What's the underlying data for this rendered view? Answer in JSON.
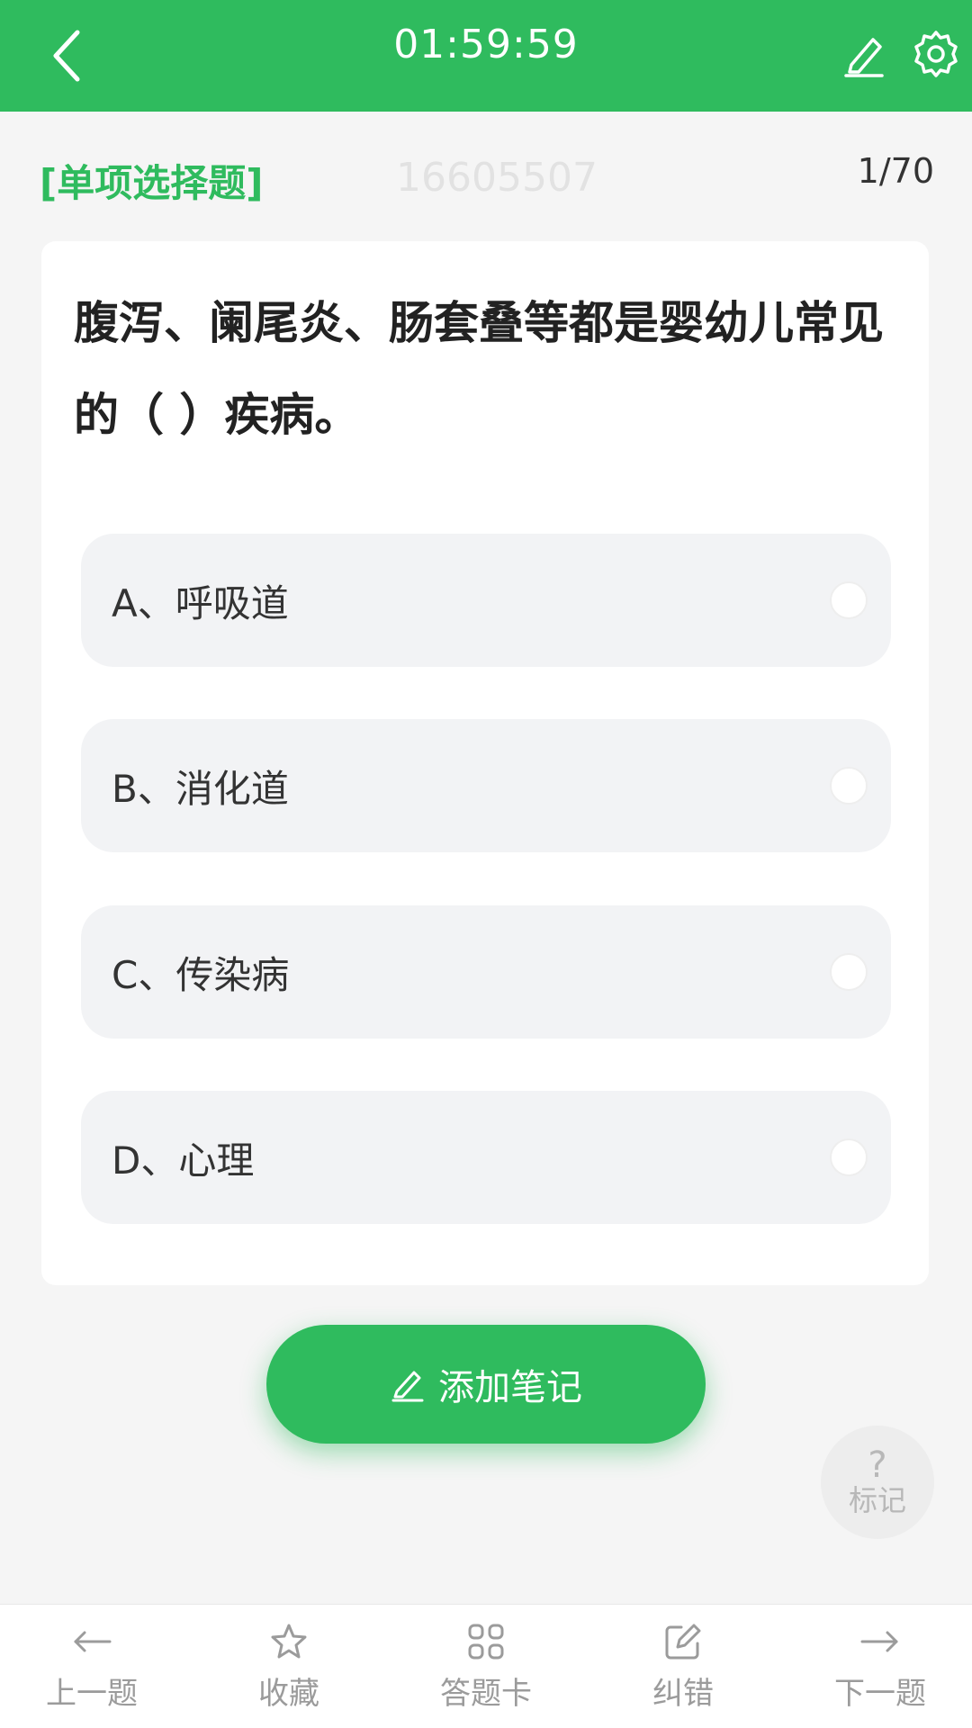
{
  "header": {
    "timer": "01:59:59",
    "bg_color": "#2fbb5e",
    "icons": [
      "back-arrow-icon",
      "pencil-icon",
      "gear-icon"
    ]
  },
  "subheader": {
    "question_type": "[单项选择题]",
    "watermark": "16605507",
    "progress": "1/70"
  },
  "question": {
    "text": "腹泻、阑尾炎、肠套叠等都是婴幼儿常见的（ ）疾病。",
    "options": [
      {
        "label": "A、呼吸道"
      },
      {
        "label": "B、消化道"
      },
      {
        "label": "C、传染病"
      },
      {
        "label": "D、心理"
      }
    ]
  },
  "note_button": {
    "label": "添加笔记",
    "icon": "pencil-icon"
  },
  "mark_button": {
    "symbol": "?",
    "label": "标记"
  },
  "bottom_nav": [
    {
      "label": "上一题",
      "icon": "arrow-left-icon"
    },
    {
      "label": "收藏",
      "icon": "star-icon"
    },
    {
      "label": "答题卡",
      "icon": "grid-icon"
    },
    {
      "label": "纠错",
      "icon": "edit-icon"
    },
    {
      "label": "下一题",
      "icon": "arrow-right-icon"
    }
  ]
}
